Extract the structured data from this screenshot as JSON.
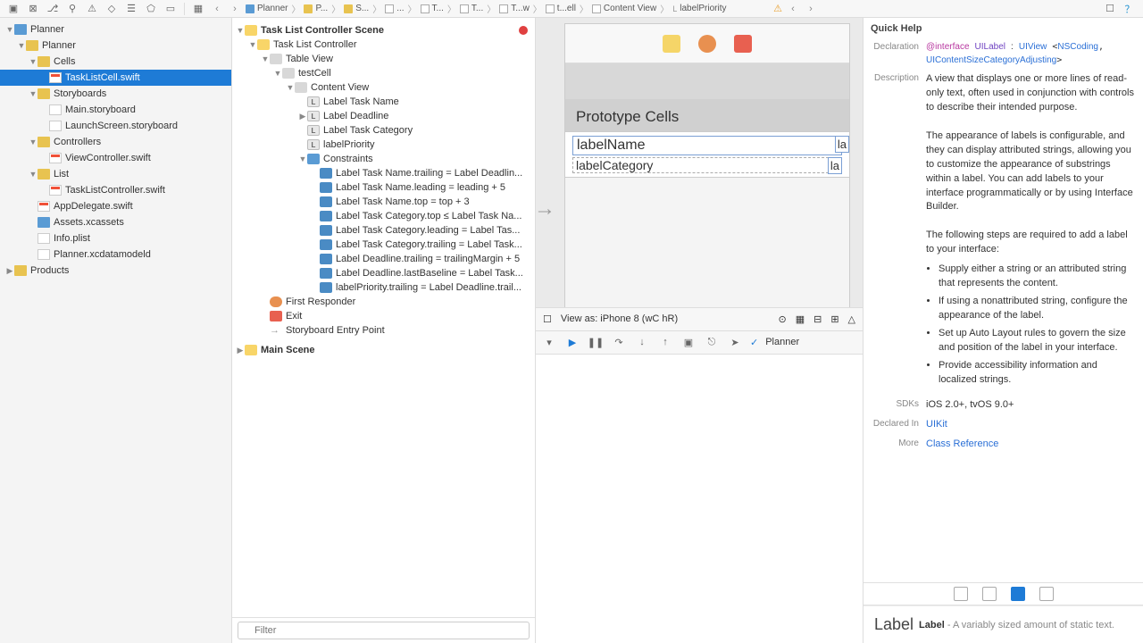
{
  "toolbar_right_icons": [
    "doc-icon",
    "help-icon"
  ],
  "breadcrumb": [
    "Planner",
    "P...",
    "S...",
    "...",
    "T...",
    "T...",
    "T...w",
    "t...ell",
    "Content View",
    "labelPriority"
  ],
  "nav_tree": [
    {
      "lvl": 0,
      "name": "Planner",
      "icon": "folder-blue",
      "open": true
    },
    {
      "lvl": 1,
      "name": "Planner",
      "icon": "folder-yellow",
      "open": true
    },
    {
      "lvl": 2,
      "name": "Cells",
      "icon": "folder-yellow",
      "open": true
    },
    {
      "lvl": 3,
      "name": "TaskListCell.swift",
      "icon": "file-swift",
      "selected": true
    },
    {
      "lvl": 2,
      "name": "Storyboards",
      "icon": "folder-yellow",
      "open": true
    },
    {
      "lvl": 3,
      "name": "Main.storyboard",
      "icon": "file-sb"
    },
    {
      "lvl": 3,
      "name": "LaunchScreen.storyboard",
      "icon": "file-sb"
    },
    {
      "lvl": 2,
      "name": "Controllers",
      "icon": "folder-yellow",
      "open": true
    },
    {
      "lvl": 3,
      "name": "ViewController.swift",
      "icon": "file-swift"
    },
    {
      "lvl": 2,
      "name": "List",
      "icon": "folder-yellow",
      "open": true
    },
    {
      "lvl": 3,
      "name": "TaskListController.swift",
      "icon": "file-swift"
    },
    {
      "lvl": 2,
      "name": "AppDelegate.swift",
      "icon": "file-swift"
    },
    {
      "lvl": 2,
      "name": "Assets.xcassets",
      "icon": "folder-blue"
    },
    {
      "lvl": 2,
      "name": "Info.plist",
      "icon": "file-sb"
    },
    {
      "lvl": 2,
      "name": "Planner.xcdatamodeld",
      "icon": "file-sb"
    },
    {
      "lvl": 0,
      "name": "Products",
      "icon": "folder-yellow",
      "open": false
    }
  ],
  "outline": {
    "scene_title": "Task List Controller Scene",
    "main_scene": "Main Scene",
    "items": [
      {
        "lvl": 0,
        "name": "Task List Controller",
        "icon": "o-vc",
        "open": true
      },
      {
        "lvl": 1,
        "name": "Table View",
        "icon": "o-view",
        "open": true
      },
      {
        "lvl": 2,
        "name": "testCell",
        "icon": "o-view",
        "open": true
      },
      {
        "lvl": 3,
        "name": "Content View",
        "icon": "o-view",
        "open": true
      },
      {
        "lvl": 4,
        "name": "Label Task Name",
        "icon": "o-label"
      },
      {
        "lvl": 4,
        "name": "Label Deadline",
        "icon": "o-label",
        "closed": true
      },
      {
        "lvl": 4,
        "name": "Label Task Category",
        "icon": "o-label"
      },
      {
        "lvl": 4,
        "name": "labelPriority",
        "icon": "o-label"
      },
      {
        "lvl": 4,
        "name": "Constraints",
        "icon": "o-constraint",
        "open": true
      },
      {
        "lvl": 5,
        "name": "Label Task Name.trailing = Label Deadlin...",
        "icon": "o-con-item"
      },
      {
        "lvl": 5,
        "name": "Label Task Name.leading = leading + 5",
        "icon": "o-con-item"
      },
      {
        "lvl": 5,
        "name": "Label Task Name.top = top + 3",
        "icon": "o-con-item"
      },
      {
        "lvl": 5,
        "name": "Label Task Category.top ≤ Label Task Na...",
        "icon": "o-con-item"
      },
      {
        "lvl": 5,
        "name": "Label Task Category.leading = Label Tas...",
        "icon": "o-con-item"
      },
      {
        "lvl": 5,
        "name": "Label Task Category.trailing = Label Task...",
        "icon": "o-con-item"
      },
      {
        "lvl": 5,
        "name": "Label Deadline.trailing = trailingMargin + 5",
        "icon": "o-con-item"
      },
      {
        "lvl": 5,
        "name": "Label Deadline.lastBaseline = Label Task...",
        "icon": "o-con-item"
      },
      {
        "lvl": 5,
        "name": "labelPriority.trailing = Label Deadline.trail...",
        "icon": "o-con-item"
      }
    ],
    "first_responder": "First Responder",
    "exit": "Exit",
    "entry": "Storyboard Entry Point"
  },
  "filter_placeholder": "Filter",
  "canvas": {
    "proto_header": "Prototype Cells",
    "label_name": "labelName",
    "label_category": "labelCategory",
    "side_la": "la",
    "side_la2": "la",
    "view_as": "View as: iPhone 8 (wC hR)"
  },
  "debug": {
    "scheme": "Planner"
  },
  "quickhelp": {
    "title": "Quick Help",
    "decl_label": "Declaration",
    "decl_code": {
      "kw": "@interface",
      "cls": "UILabel",
      "sep": ":",
      "sup": "UIView",
      "proto1": "NSCoding",
      "proto2": "UIContentSizeCategoryAdjusting"
    },
    "desc_label": "Description",
    "desc1": "A view that displays one or more lines of read-only text, often used in conjunction with controls to describe their intended purpose.",
    "desc2": "The appearance of labels is configurable, and they can display attributed strings, allowing you to customize the appearance of substrings within a label. You can add labels to your interface programmatically or by using Interface Builder.",
    "desc3": "The following steps are required to add a label to your interface:",
    "steps": [
      "Supply either a string or an attributed string that represents the content.",
      "If using a nonattributed string, configure the appearance of the label.",
      "Set up Auto Layout rules to govern the size and position of the label in your interface.",
      "Provide accessibility information and localized strings."
    ],
    "sdks_label": "SDKs",
    "sdks": "iOS 2.0+, tvOS 9.0+",
    "declared_label": "Declared In",
    "declared": "UIKit",
    "more_label": "More",
    "more": "Class Reference"
  },
  "object_lib": {
    "big": "Label",
    "name": "Label",
    "desc": "- A variably sized amount of static text."
  }
}
